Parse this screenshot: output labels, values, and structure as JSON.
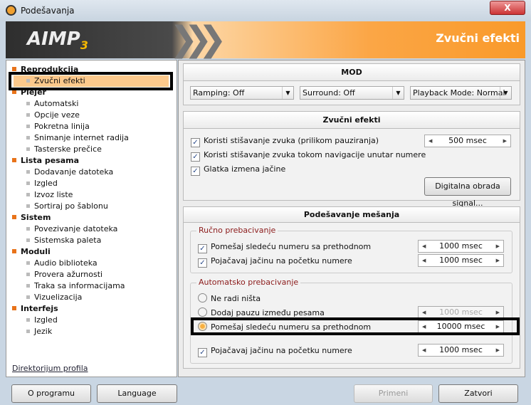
{
  "window": {
    "title": "Podešavanja",
    "close": "X"
  },
  "banner": {
    "logo": "AIMP",
    "logo_version": "3",
    "title": "Zvučni efekti"
  },
  "tree": [
    {
      "label": "Reprodukcija",
      "type": "cat"
    },
    {
      "label": "Zvučni efekti",
      "type": "sub",
      "selected": true
    },
    {
      "label": "Plejer",
      "type": "cat"
    },
    {
      "label": "Automatski",
      "type": "sub"
    },
    {
      "label": "Opcije veze",
      "type": "sub"
    },
    {
      "label": "Pokretna linija",
      "type": "sub"
    },
    {
      "label": "Snimanje internet radija",
      "type": "sub"
    },
    {
      "label": "Tasterske prečice",
      "type": "sub"
    },
    {
      "label": "Lista pesama",
      "type": "cat"
    },
    {
      "label": "Dodavanje datoteka",
      "type": "sub"
    },
    {
      "label": "Izgled",
      "type": "sub"
    },
    {
      "label": "Izvoz liste",
      "type": "sub"
    },
    {
      "label": "Sortiraj po šablonu",
      "type": "sub"
    },
    {
      "label": "Sistem",
      "type": "cat"
    },
    {
      "label": "Povezivanje datoteka",
      "type": "sub"
    },
    {
      "label": "Sistemska paleta",
      "type": "sub"
    },
    {
      "label": "Moduli",
      "type": "cat"
    },
    {
      "label": "Audio biblioteka",
      "type": "sub"
    },
    {
      "label": "Provera ažurnosti",
      "type": "sub"
    },
    {
      "label": "Traka sa informacijama",
      "type": "sub"
    },
    {
      "label": "Vizuelizacija",
      "type": "sub"
    },
    {
      "label": "Interfejs",
      "type": "cat"
    },
    {
      "label": "Izgled",
      "type": "sub"
    },
    {
      "label": "Jezik",
      "type": "sub"
    }
  ],
  "profile_link": "Direktorijum profila",
  "mod": {
    "title": "MOD",
    "ramping": "Ramping: Off",
    "surround": "Surround: Off",
    "playback": "Playback Mode: Normal"
  },
  "effects": {
    "title": "Zvučni efekti",
    "fade_pause": "Koristi stišavanje zvuka (prilikom pauziranja)",
    "fade_pause_value": "500 msec",
    "fade_nav": "Koristi stišavanje zvuka tokom navigacije unutar numere",
    "smooth_volume": "Glatka izmena jačine",
    "dsp_button": "Digitalna obrada signal..."
  },
  "mixing": {
    "title": "Podešavanje mešanja",
    "manual": {
      "title": "Ručno prebacivanje",
      "crossfade": "Pomešaj sledeću numeru sa prethodnom",
      "crossfade_value": "1000 msec",
      "fadein": "Pojačavaj jačinu na početku numere",
      "fadein_value": "1000 msec"
    },
    "auto": {
      "title": "Automatsko prebacivanje",
      "none": "Ne radi ništa",
      "pause": "Dodaj pauzu između pesama",
      "pause_value": "1000 msec",
      "crossfade": "Pomešaj sledeću numeru sa prethodnom",
      "crossfade_value": "10000 msec",
      "fadein": "Pojačavaj jačinu na početku numere",
      "fadein_value": "1000 msec"
    }
  },
  "buttons": {
    "about": "O programu",
    "language": "Language",
    "apply": "Primeni",
    "close": "Zatvori"
  }
}
